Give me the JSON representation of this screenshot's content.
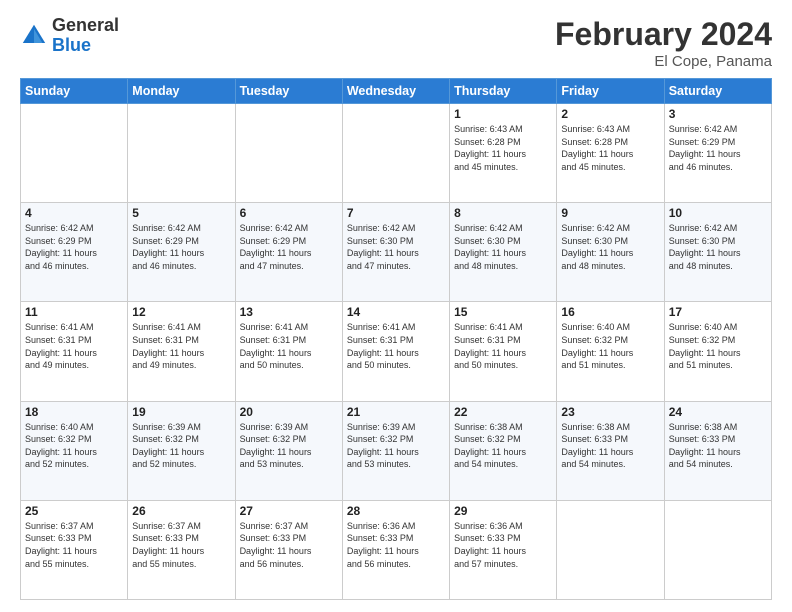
{
  "logo": {
    "general": "General",
    "blue": "Blue"
  },
  "title": {
    "month_year": "February 2024",
    "location": "El Cope, Panama"
  },
  "days_of_week": [
    "Sunday",
    "Monday",
    "Tuesday",
    "Wednesday",
    "Thursday",
    "Friday",
    "Saturday"
  ],
  "weeks": [
    [
      {
        "day": "",
        "info": ""
      },
      {
        "day": "",
        "info": ""
      },
      {
        "day": "",
        "info": ""
      },
      {
        "day": "",
        "info": ""
      },
      {
        "day": "1",
        "info": "Sunrise: 6:43 AM\nSunset: 6:28 PM\nDaylight: 11 hours\nand 45 minutes."
      },
      {
        "day": "2",
        "info": "Sunrise: 6:43 AM\nSunset: 6:28 PM\nDaylight: 11 hours\nand 45 minutes."
      },
      {
        "day": "3",
        "info": "Sunrise: 6:42 AM\nSunset: 6:29 PM\nDaylight: 11 hours\nand 46 minutes."
      }
    ],
    [
      {
        "day": "4",
        "info": "Sunrise: 6:42 AM\nSunset: 6:29 PM\nDaylight: 11 hours\nand 46 minutes."
      },
      {
        "day": "5",
        "info": "Sunrise: 6:42 AM\nSunset: 6:29 PM\nDaylight: 11 hours\nand 46 minutes."
      },
      {
        "day": "6",
        "info": "Sunrise: 6:42 AM\nSunset: 6:29 PM\nDaylight: 11 hours\nand 47 minutes."
      },
      {
        "day": "7",
        "info": "Sunrise: 6:42 AM\nSunset: 6:30 PM\nDaylight: 11 hours\nand 47 minutes."
      },
      {
        "day": "8",
        "info": "Sunrise: 6:42 AM\nSunset: 6:30 PM\nDaylight: 11 hours\nand 48 minutes."
      },
      {
        "day": "9",
        "info": "Sunrise: 6:42 AM\nSunset: 6:30 PM\nDaylight: 11 hours\nand 48 minutes."
      },
      {
        "day": "10",
        "info": "Sunrise: 6:42 AM\nSunset: 6:30 PM\nDaylight: 11 hours\nand 48 minutes."
      }
    ],
    [
      {
        "day": "11",
        "info": "Sunrise: 6:41 AM\nSunset: 6:31 PM\nDaylight: 11 hours\nand 49 minutes."
      },
      {
        "day": "12",
        "info": "Sunrise: 6:41 AM\nSunset: 6:31 PM\nDaylight: 11 hours\nand 49 minutes."
      },
      {
        "day": "13",
        "info": "Sunrise: 6:41 AM\nSunset: 6:31 PM\nDaylight: 11 hours\nand 50 minutes."
      },
      {
        "day": "14",
        "info": "Sunrise: 6:41 AM\nSunset: 6:31 PM\nDaylight: 11 hours\nand 50 minutes."
      },
      {
        "day": "15",
        "info": "Sunrise: 6:41 AM\nSunset: 6:31 PM\nDaylight: 11 hours\nand 50 minutes."
      },
      {
        "day": "16",
        "info": "Sunrise: 6:40 AM\nSunset: 6:32 PM\nDaylight: 11 hours\nand 51 minutes."
      },
      {
        "day": "17",
        "info": "Sunrise: 6:40 AM\nSunset: 6:32 PM\nDaylight: 11 hours\nand 51 minutes."
      }
    ],
    [
      {
        "day": "18",
        "info": "Sunrise: 6:40 AM\nSunset: 6:32 PM\nDaylight: 11 hours\nand 52 minutes."
      },
      {
        "day": "19",
        "info": "Sunrise: 6:39 AM\nSunset: 6:32 PM\nDaylight: 11 hours\nand 52 minutes."
      },
      {
        "day": "20",
        "info": "Sunrise: 6:39 AM\nSunset: 6:32 PM\nDaylight: 11 hours\nand 53 minutes."
      },
      {
        "day": "21",
        "info": "Sunrise: 6:39 AM\nSunset: 6:32 PM\nDaylight: 11 hours\nand 53 minutes."
      },
      {
        "day": "22",
        "info": "Sunrise: 6:38 AM\nSunset: 6:32 PM\nDaylight: 11 hours\nand 54 minutes."
      },
      {
        "day": "23",
        "info": "Sunrise: 6:38 AM\nSunset: 6:33 PM\nDaylight: 11 hours\nand 54 minutes."
      },
      {
        "day": "24",
        "info": "Sunrise: 6:38 AM\nSunset: 6:33 PM\nDaylight: 11 hours\nand 54 minutes."
      }
    ],
    [
      {
        "day": "25",
        "info": "Sunrise: 6:37 AM\nSunset: 6:33 PM\nDaylight: 11 hours\nand 55 minutes."
      },
      {
        "day": "26",
        "info": "Sunrise: 6:37 AM\nSunset: 6:33 PM\nDaylight: 11 hours\nand 55 minutes."
      },
      {
        "day": "27",
        "info": "Sunrise: 6:37 AM\nSunset: 6:33 PM\nDaylight: 11 hours\nand 56 minutes."
      },
      {
        "day": "28",
        "info": "Sunrise: 6:36 AM\nSunset: 6:33 PM\nDaylight: 11 hours\nand 56 minutes."
      },
      {
        "day": "29",
        "info": "Sunrise: 6:36 AM\nSunset: 6:33 PM\nDaylight: 11 hours\nand 57 minutes."
      },
      {
        "day": "",
        "info": ""
      },
      {
        "day": "",
        "info": ""
      }
    ]
  ]
}
